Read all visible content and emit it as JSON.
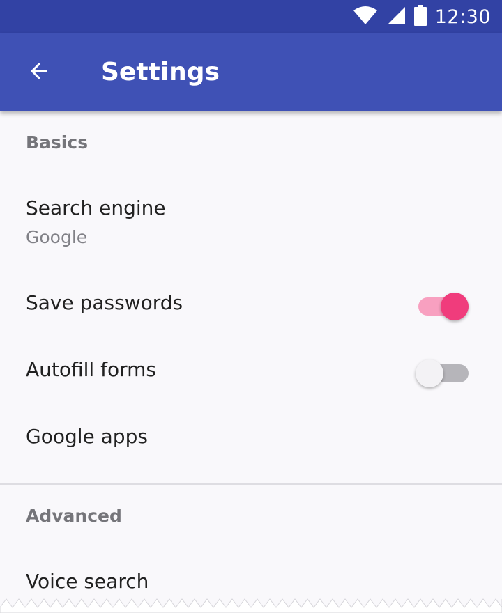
{
  "status_bar": {
    "time": "12:30",
    "icons": [
      "wifi-icon",
      "cell-signal-icon",
      "battery-icon"
    ]
  },
  "app_bar": {
    "title": "Settings",
    "back_icon": "arrow-back-icon"
  },
  "sections": {
    "basics": {
      "header": "Basics",
      "search_engine": {
        "title": "Search engine",
        "summary": "Google"
      },
      "save_passwords": {
        "title": "Save passwords",
        "enabled": true
      },
      "autofill_forms": {
        "title": "Autofill forms",
        "enabled": false
      },
      "google_apps": {
        "title": "Google apps"
      }
    },
    "advanced": {
      "header": "Advanced",
      "voice_search": {
        "title": "Voice search"
      }
    }
  },
  "colors": {
    "status_bar": "#3242a4",
    "app_bar": "#3f51b5",
    "accent": "#f03c7c",
    "background": "#f9f8fb"
  }
}
